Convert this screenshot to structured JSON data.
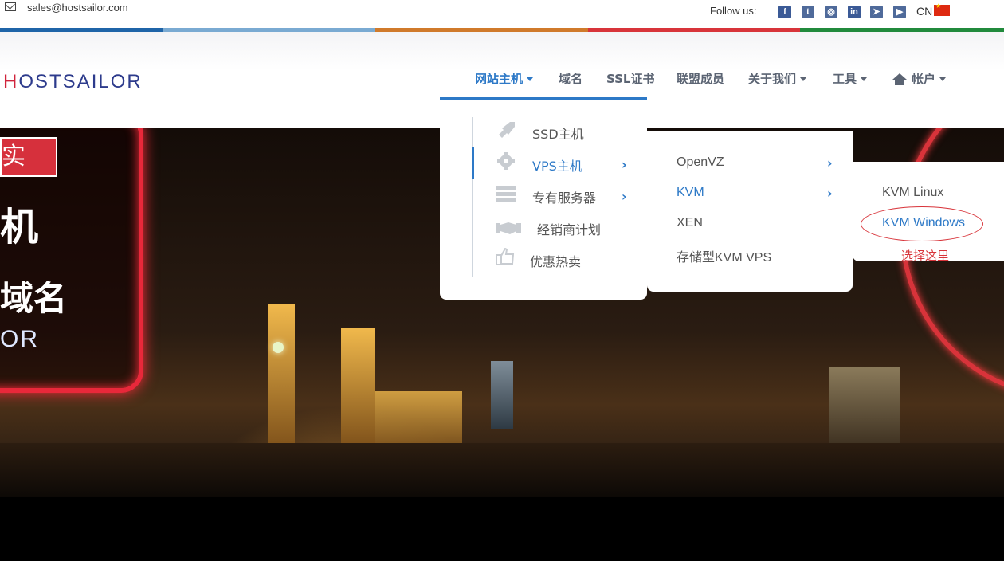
{
  "topbar": {
    "email": "sales@hostsailor.com",
    "follow_label": "Follow us:",
    "social": [
      {
        "icon": "facebook-icon",
        "glyph": "f",
        "color": "#3b5a96"
      },
      {
        "icon": "twitter-icon",
        "glyph": "t",
        "color": "#3b5a96"
      },
      {
        "icon": "instagram-icon",
        "glyph": "◎",
        "color": "#3b5a96"
      },
      {
        "icon": "linkedin-icon",
        "glyph": "in",
        "color": "#3b5a96"
      },
      {
        "icon": "telegram-icon",
        "glyph": "➤",
        "color": "#3b5a96"
      },
      {
        "icon": "youtube-icon",
        "glyph": "▶",
        "color": "#3b5a96"
      }
    ],
    "lang": "CN"
  },
  "stripe_colors": [
    "#1f64a8",
    "#7aaad2",
    "#d07a2b",
    "#d8343a",
    "#218a3c"
  ],
  "logo": {
    "text_h": "H",
    "text_rest": "OSTSAILOR"
  },
  "nav": {
    "hosting": "网站主机",
    "domain": "域名",
    "ssl": "SSL证书",
    "affiliate": "联盟成员",
    "about": "关于我们",
    "tools": "工具",
    "account": "帐户"
  },
  "hero": {
    "tag": "实",
    "big": "机",
    "mid": "域名",
    "small": "OR"
  },
  "menu1": {
    "items": [
      "SSD主机",
      "VPS主机",
      "专有服务器",
      "经销商计划",
      "优惠热卖"
    ],
    "selected": "VPS主机"
  },
  "menu2": {
    "items": [
      "OpenVZ",
      "KVM",
      "XEN",
      "存储型KVM VPS"
    ],
    "selected": "KVM"
  },
  "menu3": {
    "items": [
      "KVM Linux",
      "KVM Windows"
    ],
    "selected": "KVM Windows"
  },
  "annotation": {
    "text": "选择这里",
    "color": "#d8343a"
  },
  "colors": {
    "accent": "#2d79c7",
    "brand_red": "#d0243c",
    "brand_navy": "#2d3b8c"
  }
}
